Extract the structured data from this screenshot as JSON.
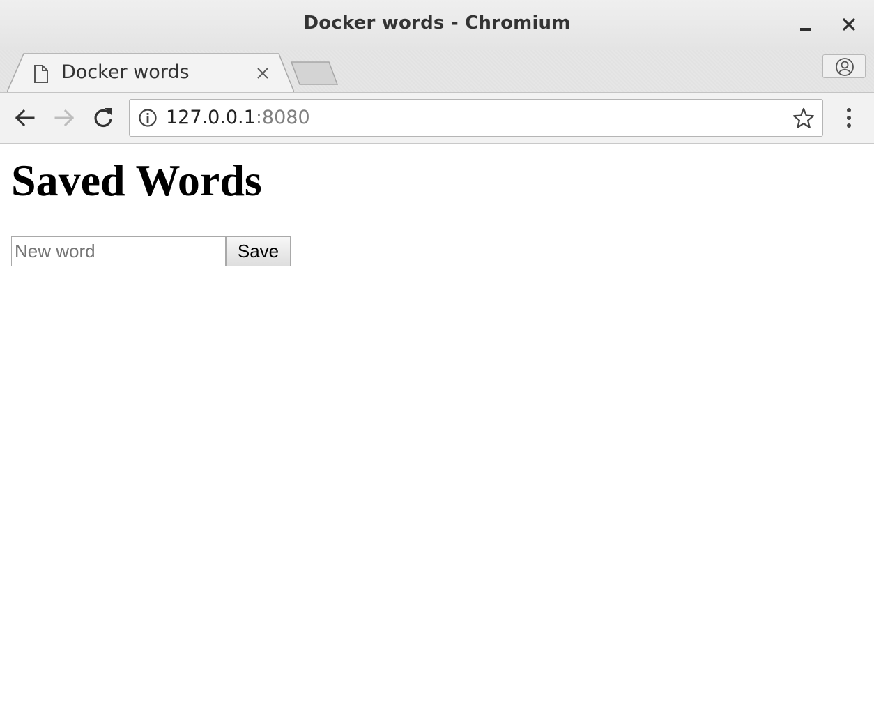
{
  "window": {
    "title": "Docker words - Chromium"
  },
  "tabs": [
    {
      "title": "Docker words",
      "active": true
    }
  ],
  "address_bar": {
    "host": "127.0.0.1",
    "port": ":8080"
  },
  "page": {
    "heading": "Saved Words",
    "form": {
      "input_placeholder": "New word",
      "input_value": "",
      "save_label": "Save"
    }
  },
  "icons": {
    "favicon": "page-icon",
    "tab_close": "close-icon",
    "new_tab": "new-tab-icon",
    "profile": "profile-icon",
    "back": "arrow-left-icon",
    "forward": "arrow-right-icon",
    "reload": "reload-icon",
    "site_info": "info-icon",
    "bookmark": "star-icon",
    "menu": "more-vertical-icon",
    "minimize": "minimize-icon",
    "window_close": "close-icon"
  },
  "colors": {
    "title_bar": "#e8e8e8",
    "toolbar": "#f2f2f2",
    "text": "#333333",
    "url_port": "#808080",
    "forward_disabled": "#bdbdbd"
  }
}
